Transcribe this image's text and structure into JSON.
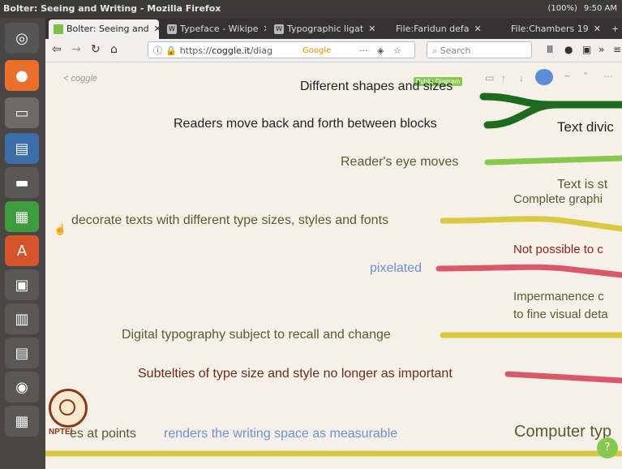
{
  "window": {
    "title": "Bolter: Seeing and Writing - Mozilla Firefox",
    "status": [
      "(100%)",
      "9:50 AM"
    ]
  },
  "tabs": [
    {
      "label": "Bolter: Seeing and",
      "icon": "coggle-icon",
      "active": true
    },
    {
      "label": "Typeface - Wikipe",
      "icon": "W",
      "active": false
    },
    {
      "label": "Typographic ligat",
      "icon": "W",
      "active": false
    },
    {
      "label": "File:Faridun defa",
      "icon": "",
      "active": false
    },
    {
      "label": "File:Chambers 19",
      "icon": "",
      "active": false
    }
  ],
  "navbar": {
    "url_prefix": "https://",
    "url_domain": "coggle.it",
    "url_rest": "/diag",
    "google": "Google",
    "search_placeholder": "Search"
  },
  "page": {
    "back_link": "< coggle",
    "public_badge": "Public Diagram",
    "colors": {
      "dark_green": "#1e6a1e",
      "light_green": "#86c94e",
      "yellow": "#d9c842",
      "red": "#d9586a",
      "blue_text": "#6e8fd0",
      "dark_text": "#222222",
      "olive_text": "#5a5a32",
      "brown_text": "#6b2a1e",
      "dark_red_text": "#8a1e1e"
    },
    "nodes_left": [
      "Different shapes and sizes",
      "Readers move back and forth between blocks",
      "Reader's eye moves",
      "decorate texts with different type sizes, styles and fonts",
      "pixelated",
      "Digital typography subject to recall and change",
      "Subtelties of type size and style no longer as important",
      "es at points",
      "renders the writing space as measurable"
    ],
    "nodes_right": [
      "Text divic",
      "Text is st",
      "Complete graphi",
      "Not possible to c",
      "Impermanence c",
      "to fine visual deta",
      "Computer typ"
    ],
    "logo_text": "NPTEL",
    "help_button": "?"
  }
}
